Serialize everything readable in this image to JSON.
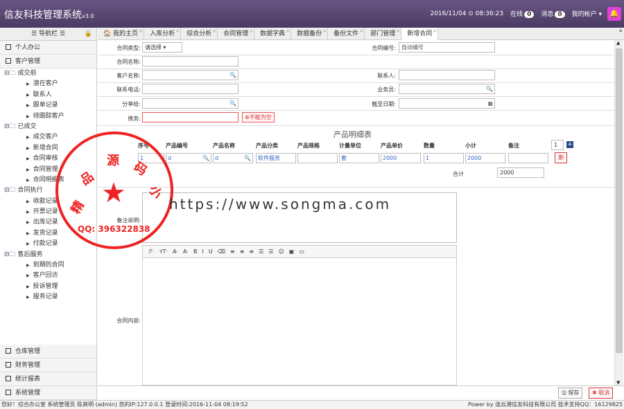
{
  "header": {
    "title": "信友科技管理系统",
    "version": "v3.0",
    "datetime": "2016/11/04 ⊙ 08:36:23",
    "online_label": "在线",
    "online_count": "0",
    "msg_label": "消息",
    "msg_count": "0",
    "account": "我的帐户 ▾"
  },
  "sidebar": {
    "nav_title": "☰ 导航栏 ☰",
    "top_sections": [
      "个人办公",
      "客户管理"
    ],
    "tree": [
      {
        "label": "成交前",
        "children": [
          "潜在客户",
          "联系人",
          "跟单记录",
          "待跟踪客户"
        ]
      },
      {
        "label": "已成交",
        "children": [
          "成交客户",
          "新增合同",
          "合同审核",
          "合同管理",
          "合同明细表"
        ]
      },
      {
        "label": "合同执行",
        "children": [
          "收款记录",
          "开票记录",
          "出库记录",
          "发货记录",
          "付款记录"
        ]
      },
      {
        "label": "售后服务",
        "children": [
          "到期的合同",
          "客户回访",
          "投诉管理",
          "服务记录"
        ]
      }
    ],
    "bottom_sections": [
      "仓库管理",
      "财务管理",
      "统计报表",
      "系统管理"
    ]
  },
  "tabs": [
    "我的主页",
    "入库分析",
    "综合分析",
    "合同管理",
    "数据字典",
    "数据备份",
    "备份文件",
    "部门管理",
    "新增合同"
  ],
  "form": {
    "contract_type_label": "合同类型:",
    "contract_type_value": "请选择 ▾",
    "contract_no_label": "合同编号:",
    "contract_no_value": "自动编号",
    "contract_name_label": "合同名称:",
    "customer_label": "客户名称:",
    "contact_label": "联系人:",
    "phone_label": "联系电话:",
    "sales_label": "业务员:",
    "share_label": "分享给:",
    "deadline_label": "截至日期:",
    "debt_label": "债务:",
    "error_text": "不能为空",
    "product_title": "产品明细表",
    "product_headers": [
      "序号",
      "产品编号",
      "产品名称",
      "产品分类",
      "产品规格",
      "计量单位",
      "产品单价",
      "数量",
      "小计",
      "备注"
    ],
    "row_count": "1",
    "product_row": [
      "1",
      "d",
      "d",
      "软件服务",
      "",
      "套",
      "2000",
      "1",
      "2000",
      ""
    ],
    "delete_label": "删",
    "total_label": "合计",
    "total_value": "2000",
    "remark_label": "备注说明:",
    "content_label": "合同内容:",
    "editor_tools": [
      "ℱ·",
      "тT·",
      "A·",
      "A·",
      "B",
      "I",
      "U",
      "⌫",
      "≡",
      "≡",
      "≡",
      "☰",
      "☰",
      "☺",
      "▣",
      "▭"
    ]
  },
  "actions": {
    "save": "保存",
    "cancel": "取消"
  },
  "footer": {
    "left": "您好！综合办公室 系统管理员 陈爽明 (admin) 您的IP:127.0.0.1 登录时间:2016-11-04 08:19:52",
    "right": "Power by 连云港信友科技有限公司 技术支持QQ：16129825"
  },
  "stamp": {
    "chars": [
      "精",
      "品",
      "源",
      "码",
      "小"
    ],
    "qq": "QQ: 396322838"
  },
  "watermark": "https://www.songma.com"
}
